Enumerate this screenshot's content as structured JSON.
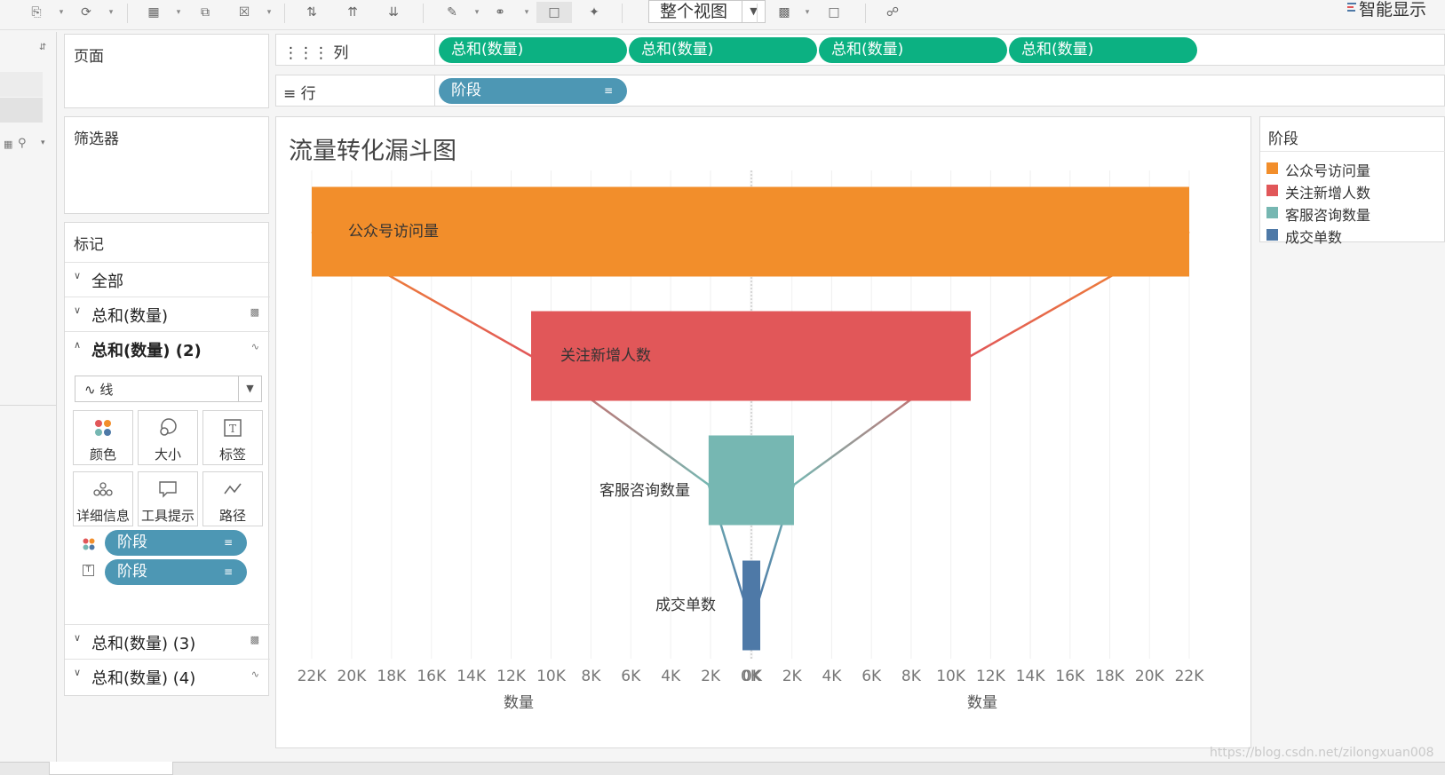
{
  "toolbar": {
    "view_mode": "整个视图",
    "smart_show": "智能显示"
  },
  "side": {
    "pages_title": "页面",
    "filters_title": "筛选器",
    "marks_title": "标记",
    "marks_cards": [
      {
        "label": "全部",
        "expanded": false,
        "icon": "none"
      },
      {
        "label": "总和(数量)",
        "expanded": false,
        "icon": "bar-icon"
      },
      {
        "label": "总和(数量) (2)",
        "expanded": true,
        "icon": "line-icon"
      },
      {
        "label": "总和(数量) (3)",
        "expanded": false,
        "icon": "bar-icon"
      },
      {
        "label": "总和(数量) (4)",
        "expanded": false,
        "icon": "line-icon"
      }
    ],
    "mark_type": "线",
    "buttons": [
      "颜色",
      "大小",
      "标签",
      "详细信息",
      "工具提示",
      "路径"
    ],
    "mark_pills": [
      "阶段",
      "阶段"
    ]
  },
  "shelves": {
    "columns_label": "列",
    "rows_label": "行",
    "column_pills": [
      "总和(数量)",
      "总和(数量)",
      "总和(数量)",
      "总和(数量)"
    ],
    "row_pills": [
      "阶段"
    ]
  },
  "legend": {
    "title": "阶段",
    "items": [
      {
        "label": "公众号访问量",
        "color": "#f28e2b"
      },
      {
        "label": "关注新增人数",
        "color": "#e15759"
      },
      {
        "label": "客服咨询数量",
        "color": "#76b7b2"
      },
      {
        "label": "成交单数",
        "color": "#4e79a7"
      }
    ]
  },
  "chart_data": {
    "type": "bar",
    "title": "流量转化漏斗图",
    "subtype": "mirrored-funnel",
    "categories": [
      "公众号访问量",
      "关注新增人数",
      "客服咨询数量",
      "成交单数"
    ],
    "colors": [
      "#f28e2b",
      "#e15759",
      "#76b7b2",
      "#4e79a7"
    ],
    "series": [
      {
        "values": [
          22000,
          11000,
          2100,
          450
        ]
      },
      {
        "values": [
          22000,
          11000,
          2100,
          450
        ]
      }
    ],
    "xlabel_left": "数量",
    "xlabel_right": "数量",
    "x_ticks_left": [
      "22K",
      "20K",
      "18K",
      "16K",
      "14K",
      "12K",
      "10K",
      "8K",
      "6K",
      "4K",
      "2K",
      "0K"
    ],
    "x_ticks_right": [
      "0K",
      "2K",
      "4K",
      "6K",
      "8K",
      "10K",
      "12K",
      "14K",
      "16K",
      "18K",
      "20K",
      "22K"
    ],
    "xlim": [
      0,
      22000
    ],
    "grid": true,
    "left_axis_reversed": true
  },
  "watermark": "https://blog.csdn.net/zilongxuan008"
}
